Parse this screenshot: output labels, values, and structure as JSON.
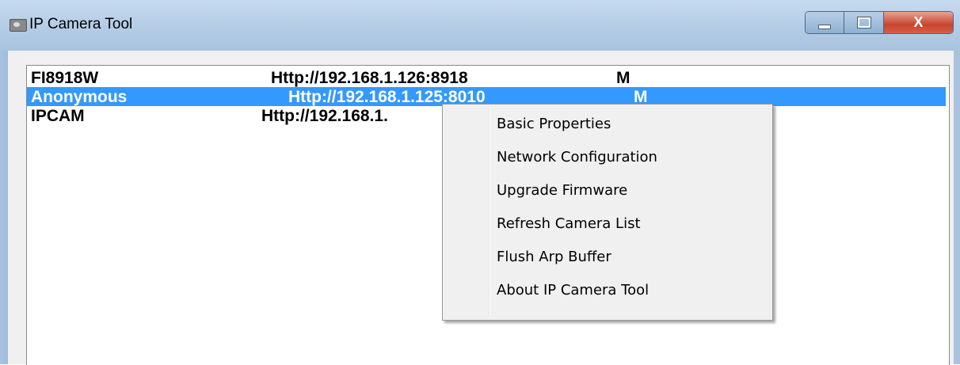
{
  "window": {
    "title": "IP Camera Tool",
    "controls": {
      "minimize_icon": "minimize-icon",
      "maximize_icon": "maximize-icon",
      "close_label": "X"
    }
  },
  "camera_list": {
    "rows": [
      {
        "name": "FI8918W",
        "url": "Http://192.168.1.126:8918",
        "mode": "M",
        "selected": false
      },
      {
        "name": "Anonymous",
        "url": "Http://192.168.1.125:8010",
        "mode": "M",
        "selected": true
      },
      {
        "name": "IPCAM",
        "url": "Http://192.168.1.",
        "mode": "",
        "selected": false
      }
    ],
    "selection_color": "#3399ff"
  },
  "context_menu": {
    "items": [
      "Basic Properties",
      "Network Configuration",
      "Upgrade Firmware",
      "Refresh Camera List",
      "Flush Arp Buffer",
      "About IP Camera Tool"
    ]
  }
}
